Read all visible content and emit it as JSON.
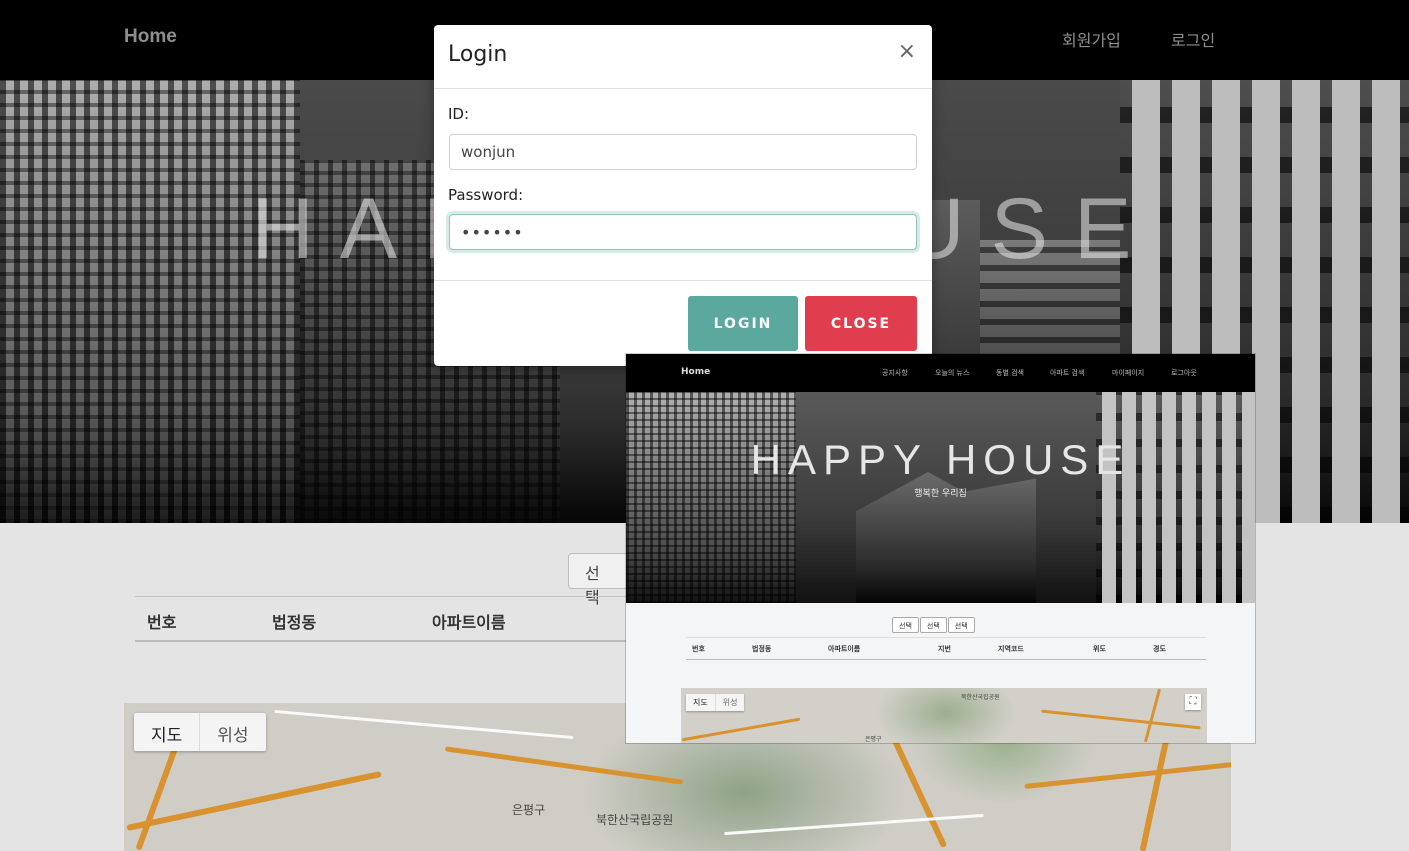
{
  "background_page": {
    "navbar": {
      "brand": "Home",
      "links": [
        "회원가입",
        "로그인"
      ]
    },
    "hero_title": "HAPPY HOUSE",
    "select_label": "선택",
    "table_headers": [
      "번호",
      "법정동",
      "아파트이름"
    ],
    "map": {
      "type_buttons": [
        "지도",
        "위성"
      ],
      "labels": [
        "은평구",
        "북한산국립공원"
      ]
    }
  },
  "login_modal": {
    "title": "Login",
    "close_symbol": "×",
    "id_label": "ID:",
    "id_value": "wonjun",
    "password_label": "Password:",
    "password_value": "••••••",
    "login_button": "LOGIN",
    "close_button": "CLOSE"
  },
  "screenshot_preview": {
    "navbar": {
      "brand": "Home",
      "links": [
        "공지사항",
        "오늘의 뉴스",
        "동별 검색",
        "아파트 검색",
        "마이페이지",
        "로그아웃"
      ]
    },
    "hero_title": "HAPPY HOUSE",
    "hero_subtitle": "행복한 우리집",
    "selects": [
      "선택",
      "선택",
      "선택"
    ],
    "table_headers": [
      "번호",
      "법정동",
      "아파트이름",
      "지번",
      "지역코드",
      "위도",
      "경도"
    ],
    "map": {
      "type_buttons": [
        "지도",
        "위성"
      ],
      "labels": [
        "북한산국립공원",
        "은평구"
      ],
      "fullscreen_symbol": "⛶"
    }
  },
  "colors": {
    "login_button": "#5ba89e",
    "close_button": "#e03e4e",
    "navbar": "#000000"
  }
}
